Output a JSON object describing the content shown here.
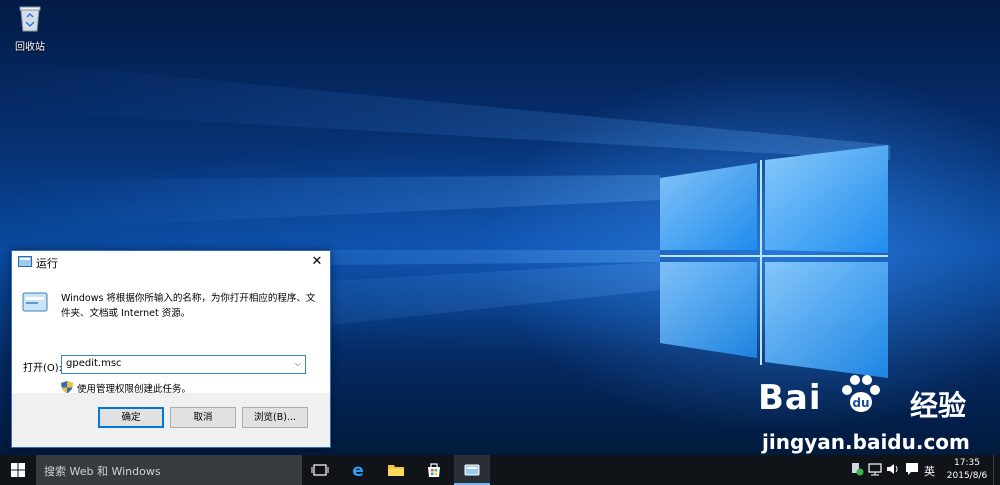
{
  "desktop": {
    "recycle_bin_label": "回收站",
    "watermark": {
      "brand": "Bai",
      "brand_suffix": "经验",
      "url": "jingyan.baidu.com"
    }
  },
  "run_dialog": {
    "title": "运行",
    "close_icon": "close-icon",
    "description": "Windows 将根据你所输入的名称，为你打开相应的程序、文件夹、文档或 Internet 资源。",
    "open_label": "打开(O):",
    "input_value": "gpedit.msc",
    "admin_note": "使用管理权限创建此任务。",
    "buttons": {
      "ok": "确定",
      "cancel": "取消",
      "browse": "浏览(B)..."
    }
  },
  "taskbar": {
    "search_placeholder": "搜索 Web 和 Windows",
    "ime_label": "英",
    "time": "17:35",
    "date": "2015/8/6",
    "accent": "#0078d7"
  }
}
